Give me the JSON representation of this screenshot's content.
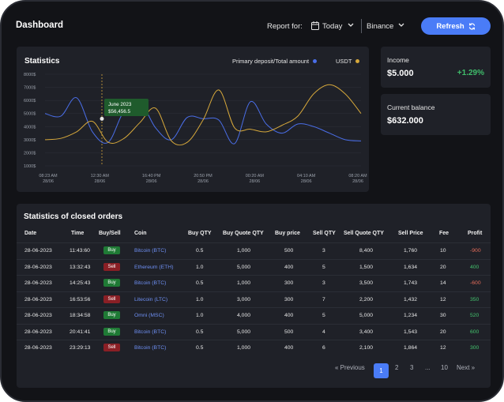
{
  "header": {
    "title": "Dashboard",
    "report_label": "Report for:",
    "period": "Today",
    "exchange": "Binance",
    "refresh_label": "Refresh"
  },
  "statistics": {
    "title": "Statistics",
    "legend_primary": "Primary deposit/Total amount",
    "legend_usdt": "USDT",
    "tooltip_date": "June 2023",
    "tooltip_value": "$56,456.5"
  },
  "income": {
    "label": "Income",
    "value": "$5.000",
    "change": "+1.29%"
  },
  "balance": {
    "label": "Current balance",
    "value": "$632.000"
  },
  "orders": {
    "title": "Statistics of closed orders",
    "columns": [
      "Date",
      "Time",
      "Buy/Sell",
      "Coin",
      "Buy QTY",
      "Buy Quote QTY",
      "Buy price",
      "Sell QTY",
      "Sell Quote QTY",
      "Sell Price",
      "Fee",
      "Profit"
    ],
    "rows": [
      {
        "date": "28-06-2023",
        "time": "11:43:60",
        "side": "Buy",
        "coin": "Bitcoin (BTC)",
        "buy_qty": "0.5",
        "buy_quote": "1,000",
        "buy_price": "500",
        "sell_qty": "3",
        "sell_quote": "8,400",
        "sell_price": "1,760",
        "fee": "10",
        "profit": "-900"
      },
      {
        "date": "28-06-2023",
        "time": "13:32:43",
        "side": "Sell",
        "coin": "Ethereum (ETH)",
        "buy_qty": "1.0",
        "buy_quote": "5,000",
        "buy_price": "400",
        "sell_qty": "5",
        "sell_quote": "1,500",
        "sell_price": "1,634",
        "fee": "20",
        "profit": "400"
      },
      {
        "date": "28-06-2023",
        "time": "14:25:43",
        "side": "Buy",
        "coin": "Bitcoin (BTC)",
        "buy_qty": "0.5",
        "buy_quote": "1,000",
        "buy_price": "300",
        "sell_qty": "3",
        "sell_quote": "3,500",
        "sell_price": "1,743",
        "fee": "14",
        "profit": "-600"
      },
      {
        "date": "28-06-2023",
        "time": "16:53:56",
        "side": "Sell",
        "coin": "Litecoin (LTC)",
        "buy_qty": "1.0",
        "buy_quote": "3,000",
        "buy_price": "300",
        "sell_qty": "7",
        "sell_quote": "2,200",
        "sell_price": "1,432",
        "fee": "12",
        "profit": "350"
      },
      {
        "date": "28-06-2023",
        "time": "18:34:58",
        "side": "Buy",
        "coin": "Omni (MSC)",
        "buy_qty": "1.0",
        "buy_quote": "4,000",
        "buy_price": "400",
        "sell_qty": "5",
        "sell_quote": "5,000",
        "sell_price": "1,234",
        "fee": "30",
        "profit": "520"
      },
      {
        "date": "28-06-2023",
        "time": "20:41:41",
        "side": "Buy",
        "coin": "Bitcoin (BTC)",
        "buy_qty": "0.5",
        "buy_quote": "5,000",
        "buy_price": "500",
        "sell_qty": "4",
        "sell_quote": "3,400",
        "sell_price": "1,543",
        "fee": "20",
        "profit": "600"
      },
      {
        "date": "28-06-2023",
        "time": "23:29:13",
        "side": "Sell",
        "coin": "Bitcoin (BTC)",
        "buy_qty": "0.5",
        "buy_quote": "1,000",
        "buy_price": "400",
        "sell_qty": "6",
        "sell_quote": "2,100",
        "sell_price": "1,864",
        "fee": "12",
        "profit": "300"
      }
    ]
  },
  "pagination": {
    "previous": "« Previous",
    "pages": [
      "1",
      "2",
      "3",
      "...",
      "10"
    ],
    "next": "Next »"
  },
  "chart_data": {
    "type": "line",
    "y_ticks": [
      "8000$",
      "7000$",
      "6000$",
      "5000$",
      "4000$",
      "3000$",
      "2000$",
      "1000$"
    ],
    "x_ticks": [
      {
        "time": "08:23 AM",
        "date": "28/06"
      },
      {
        "time": "12:30 AM",
        "date": "28/06"
      },
      {
        "time": "16:40 PM",
        "date": "28/06"
      },
      {
        "time": "20:50 PM",
        "date": "28/06"
      },
      {
        "time": "00:20 AM",
        "date": "28/06"
      },
      {
        "time": "04:10 AM",
        "date": "28/06"
      },
      {
        "time": "08:20 AM",
        "date": "28/06"
      }
    ],
    "ylim": [
      1000,
      8000
    ],
    "series": [
      {
        "name": "Primary deposit/Total amount",
        "color": "#4a6ee8",
        "values": [
          5000,
          4800,
          6200,
          3600,
          2800,
          5200,
          5900,
          3900,
          3000,
          4700,
          4600,
          4500,
          2700,
          5900,
          4200,
          3500,
          4200,
          4000,
          3500,
          3000,
          2900
        ]
      },
      {
        "name": "USDT",
        "color": "#d6a83b",
        "values": [
          3000,
          3100,
          3600,
          4400,
          2800,
          3100,
          4300,
          5400,
          2900,
          2800,
          4500,
          6800,
          3900,
          3800,
          3600,
          4100,
          4800,
          6500,
          7200,
          6500,
          5000
        ]
      }
    ],
    "grid": true
  }
}
